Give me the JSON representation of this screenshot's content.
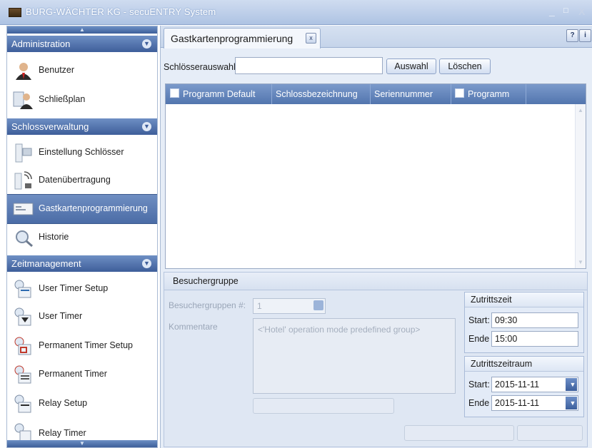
{
  "window": {
    "title": "BURG-WÄCHTER KG - secuENTRY System",
    "minimize": "_",
    "maximize": "□",
    "close": "X"
  },
  "sidebar": {
    "sections": [
      {
        "label": "Administration",
        "items": [
          "Benutzer",
          "Schließplan"
        ]
      },
      {
        "label": "Schlossverwaltung",
        "items": [
          "Einstellung Schlösser",
          "Datenübertragung",
          "Gastkartenprogrammierung",
          "Historie"
        ]
      },
      {
        "label": "Zeitmanagement",
        "items": [
          "User Timer Setup",
          "User Timer",
          "Permanent Timer Setup",
          "Permanent Timer",
          "Relay Setup",
          "Relay Timer"
        ]
      }
    ],
    "active_item": "Gastkartenprogrammierung"
  },
  "tab": {
    "label": "Gastkartenprogrammierung",
    "close": "x"
  },
  "help": {
    "question": "?",
    "info": "i"
  },
  "selection": {
    "label": "Schlösserauswahl",
    "value": "",
    "select_btn": "Auswahl",
    "delete_btn": "Löschen"
  },
  "grid": {
    "columns": [
      "Programm Default",
      "Schlossbezeichnung",
      "Seriennummer",
      "Programm"
    ],
    "rows": []
  },
  "visitor_group": {
    "title": "Besuchergruppe",
    "group_label": "Besuchergruppen #:",
    "group_value": "1",
    "comment_label": "Kommentare",
    "comment_value": "<'Hotel' operation mode predefined group>"
  },
  "access_time": {
    "title": "Zutrittszeit",
    "start_label": "Start:",
    "start_value": "09:30",
    "end_label": "Ende",
    "end_value": "15:00"
  },
  "access_period": {
    "title": "Zutrittszeitraum",
    "start_label": "Start:",
    "start_value": "2015-11-11",
    "end_label": "Ende",
    "end_value": "2015-11-11"
  },
  "colors": {
    "header_blue": "#5275ae",
    "title_bar": "#aec3e3",
    "panel_bg": "#dfe7f3"
  }
}
